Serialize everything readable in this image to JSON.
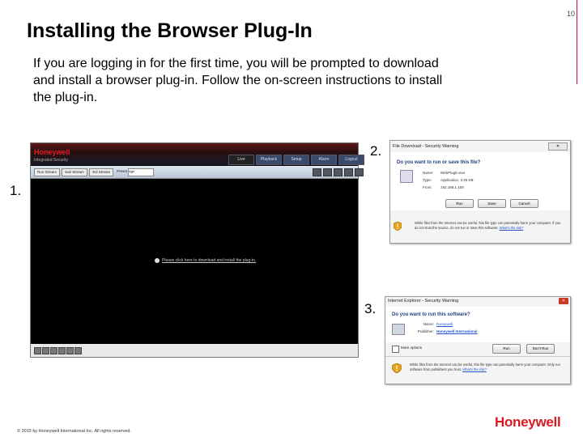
{
  "page_number": "10",
  "title": "Installing the Browser Plug-In",
  "intro": "If you are logging in for the first time, you will be prompted to download and install a browser plug-in. Follow the on-screen instructions to install the plug-in.",
  "steps": {
    "one": "1.",
    "two": "2.",
    "three": "3."
  },
  "screenshot1": {
    "logo": "Honeywell",
    "subtitle": "Integrated Security",
    "tabs": [
      "Live",
      "Playback",
      "Setup",
      "Alarm",
      "Logout"
    ],
    "toolbar": {
      "buttons": [
        "Run Stream",
        "Sub Stream",
        "3rd Stream"
      ],
      "ptz_label": "Preset",
      "ptz_value": "TIP"
    },
    "plugin_link": "Please click here to download and install the plug-in."
  },
  "dialog2": {
    "title": "File Download - Security Warning",
    "close": "✕",
    "question": "Do you want to run or save this file?",
    "name_label": "Name:",
    "name_value": "WebPlugin.exe",
    "type_label": "Type:",
    "type_value": "Application, 3.45 KB",
    "from_label": "From:",
    "from_value": "192.168.1.108",
    "buttons": {
      "run": "Run",
      "save": "Save",
      "cancel": "Cancel"
    },
    "note": "While files from the Internet can be useful, this file type can potentially harm your computer. If you do not trust the source, do not run or save this software.",
    "risk_link": "What's the risk?"
  },
  "dialog3": {
    "title": "Internet Explorer - Security Warning",
    "close": "✕",
    "question": "Do you want to run this software?",
    "name_label": "Name:",
    "name_value": "honeywell",
    "publisher_label": "Publisher:",
    "publisher_value": "Honeywell International",
    "more_options": "More options",
    "buttons": {
      "run": "Run",
      "dont_run": "Don't Run"
    },
    "note": "While files from the Internet can be useful, this file type can potentially harm your computer. Only run software from publishers you trust.",
    "risk_link": "What's the risk?"
  },
  "footer": "© 2015 by Honeywell International Inc. All rights reserved.",
  "brand": "Honeywell"
}
